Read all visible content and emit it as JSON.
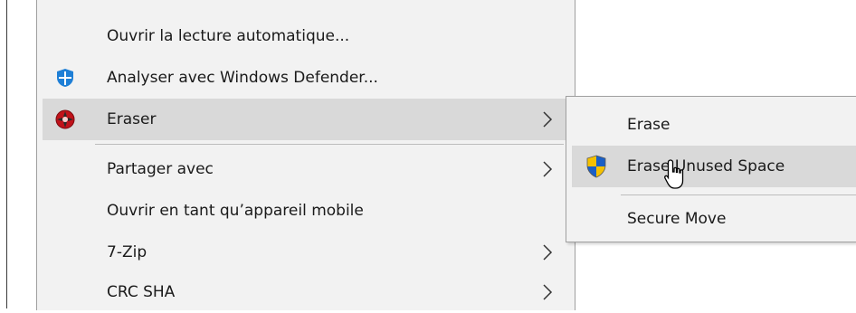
{
  "context_menu": {
    "items": [
      {
        "label": "Ouvrir la lecture automatique...",
        "icon": "none"
      },
      {
        "label": "Analyser avec Windows Defender...",
        "icon": "windows-defender-icon"
      },
      {
        "label": "Eraser",
        "icon": "eraser-icon",
        "has_submenu": true,
        "highlighted": true
      },
      {
        "label": "Partager avec",
        "has_submenu": true
      },
      {
        "label": "Ouvrir en tant qu’appareil mobile"
      },
      {
        "label": "7-Zip",
        "has_submenu": true
      },
      {
        "label": "CRC SHA",
        "has_submenu": true
      }
    ]
  },
  "eraser_submenu": {
    "items": [
      {
        "label": "Erase"
      },
      {
        "label": "Erase Unused Space",
        "icon": "uac-shield-icon",
        "highlighted": true
      },
      {
        "label": "Secure Move"
      }
    ]
  },
  "colors": {
    "menu_background": "#f2f2f2",
    "hover_background": "#d9d9d9",
    "defender_blue": "#1e7fd6",
    "eraser_red": "#c0121a"
  }
}
